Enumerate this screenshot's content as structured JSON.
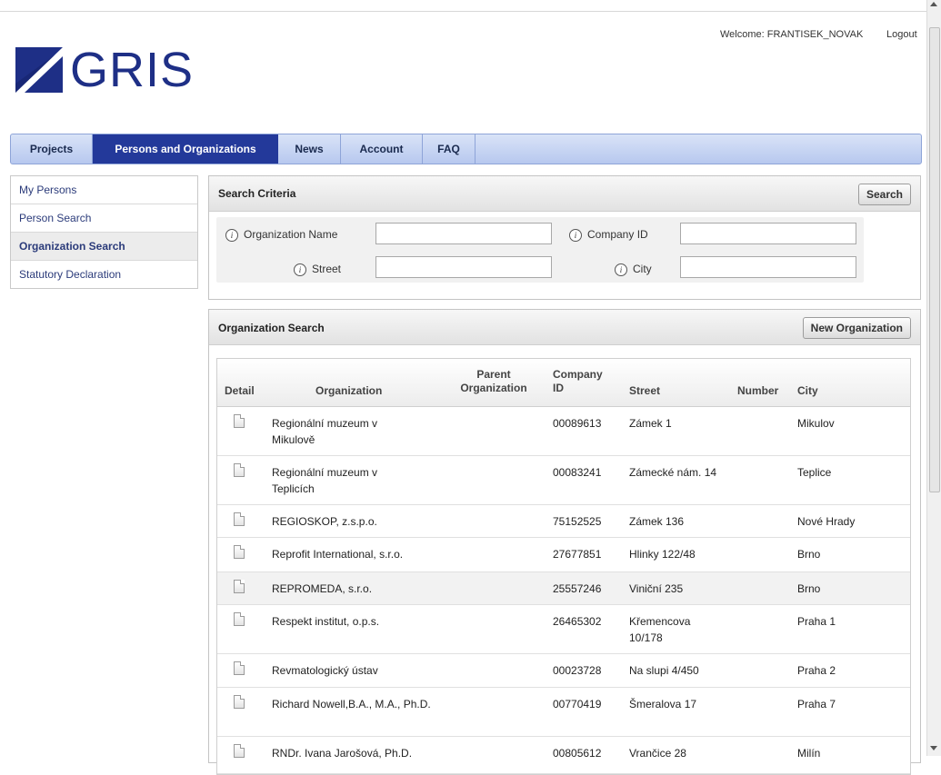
{
  "header": {
    "logo_text": "GRIS",
    "welcome": "Welcome: FRANTISEK_NOVAK",
    "logout": "Logout"
  },
  "mainnav": {
    "tabs": [
      {
        "label": "Projects",
        "active": false
      },
      {
        "label": "Persons and Organizations",
        "active": true
      },
      {
        "label": "News",
        "active": false
      },
      {
        "label": "Account",
        "active": false
      },
      {
        "label": "FAQ",
        "active": false
      }
    ]
  },
  "sidebar": {
    "items": [
      {
        "label": "My Persons",
        "active": false
      },
      {
        "label": "Person Search",
        "active": false
      },
      {
        "label": "Organization Search",
        "active": true
      },
      {
        "label": "Statutory Declaration",
        "active": false
      }
    ]
  },
  "search_criteria": {
    "title": "Search Criteria",
    "search_button": "Search",
    "fields": {
      "organization_name": {
        "label": "Organization Name",
        "value": ""
      },
      "company_id": {
        "label": "Company ID",
        "value": ""
      },
      "street": {
        "label": "Street",
        "value": ""
      },
      "city": {
        "label": "City",
        "value": ""
      }
    }
  },
  "results": {
    "title": "Organization Search",
    "new_button": "New Organization",
    "columns": {
      "detail": "Detail",
      "organization": "Organization",
      "parent": "Parent Organization",
      "company_id": "Company ID",
      "street": "Street",
      "number": "Number",
      "city": "City"
    },
    "rows": [
      {
        "organization": "Regionální muzeum v Mikulově",
        "parent": "",
        "company_id": "00089613",
        "street": "Zámek 1",
        "number": "",
        "city": "Mikulov"
      },
      {
        "organization": "Regionální muzeum v Teplicích",
        "parent": "",
        "company_id": "00083241",
        "street": "Zámecké nám. 14",
        "number": "",
        "city": "Teplice"
      },
      {
        "organization": "REGIOSKOP, z.s.p.o.",
        "parent": "",
        "company_id": "75152525",
        "street": "Zámek 136",
        "number": "",
        "city": "Nové Hrady"
      },
      {
        "organization": "Reprofit International, s.r.o.",
        "parent": "",
        "company_id": "27677851",
        "street": "Hlinky 122/48",
        "number": "",
        "city": "Brno"
      },
      {
        "organization": "REPROMEDA, s.r.o.",
        "parent": "",
        "company_id": "25557246",
        "street": "Viniční 235",
        "number": "",
        "city": "Brno"
      },
      {
        "organization": "Respekt institut, o.p.s.",
        "parent": "",
        "company_id": "26465302",
        "street": "Křemencova 10/178",
        "number": "",
        "city": "Praha 1"
      },
      {
        "organization": "Revmatologický ústav",
        "parent": "",
        "company_id": "00023728",
        "street": "Na slupi 4/450",
        "number": "",
        "city": "Praha 2"
      },
      {
        "organization": "Richard Nowell,B.A., M.A., Ph.D.",
        "parent": "",
        "company_id": "00770419",
        "street": "Šmeralova 17",
        "number": "",
        "city": "Praha 7"
      },
      {
        "organization": "RNDr. Ivana Jarošová, Ph.D.",
        "parent": "",
        "company_id": "00805612",
        "street": "Vrančice 28",
        "number": "",
        "city": "Milín"
      }
    ]
  }
}
